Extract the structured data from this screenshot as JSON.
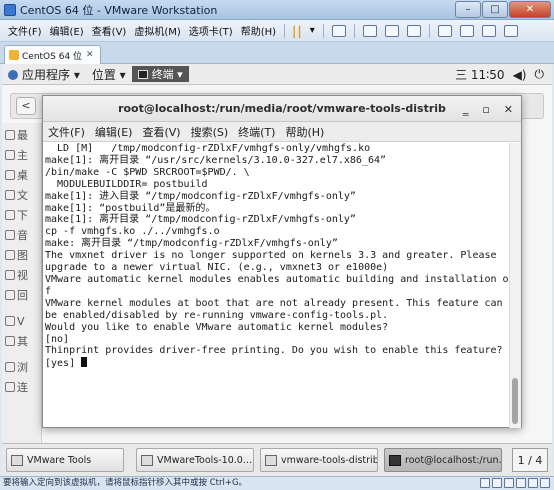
{
  "window": {
    "title": "CentOS 64 位 - VMware Workstation",
    "controls": {
      "minimize": "–",
      "maximize": "□",
      "close": "✕"
    }
  },
  "menubar": {
    "items": [
      "文件(F)",
      "编辑(E)",
      "查看(V)",
      "虚拟机(M)",
      "选项卡(T)",
      "帮助(H)"
    ],
    "dropdown_arrow": "▾"
  },
  "vm_tab": {
    "label": "CentOS 64 位",
    "close": "✕"
  },
  "gnome_topbar": {
    "applications": "应用程序 ▾",
    "places": "位置 ▾",
    "terminal_label": "终端 ▾",
    "clock": "三 11∶50",
    "volume_icon": "◀)",
    "power_icon": "⏻"
  },
  "files_window": {
    "back_button": "<",
    "sidebar_labels": [
      "最",
      "主",
      "桌",
      "文",
      "下",
      "音",
      "图",
      "视",
      "回",
      "V",
      "其",
      "浏",
      "连"
    ]
  },
  "terminal": {
    "title": "root@localhost:/run/media/root/vmware-tools-distrib",
    "controls": {
      "minimize": "‗",
      "maximize": "▫",
      "close": "✕"
    },
    "menu": [
      "文件(F)",
      "编辑(E)",
      "查看(V)",
      "搜索(S)",
      "终端(T)",
      "帮助(H)"
    ],
    "lines": [
      "  LD [M]   /tmp/modconfig-rZDlxF/vmhgfs-only/vmhgfs.ko",
      "make[1]: 离开目录 “/usr/src/kernels/3.10.0-327.el7.x86_64”",
      "/bin/make -C $PWD SRCROOT=$PWD/. \\",
      "  MODULEBUILDDIR= postbuild",
      "make[1]: 进入目录 “/tmp/modconfig-rZDlxF/vmhgfs-only”",
      "make[1]: “postbuild”是最新的。",
      "make[1]: 离开目录 “/tmp/modconfig-rZDlxF/vmhgfs-only”",
      "cp -f vmhgfs.ko ./../vmhgfs.o",
      "make: 离开目录 “/tmp/modconfig-rZDlxF/vmhgfs-only”",
      "",
      "The vmxnet driver is no longer supported on kernels 3.3 and greater. Please",
      "upgrade to a newer virtual NIC. (e.g., vmxnet3 or e1000e)",
      "",
      "VMware automatic kernel modules enables automatic building and installation o",
      "f",
      "VMware kernel modules at boot that are not already present. This feature can",
      "be enabled/disabled by re-running vmware-config-tools.pl.",
      "",
      "Would you like to enable VMware automatic kernel modules?",
      "[no]",
      "",
      "Thinprint provides driver-free printing. Do you wish to enable this feature?",
      "[yes] "
    ]
  },
  "taskbar": {
    "tasks": [
      "VMware Tools",
      "VMwareTools-10.0.…",
      "vmware-tools-distrib",
      "root@localhost:/run…"
    ],
    "workspace": "1 / 4"
  },
  "statusbar": {
    "text": "要将输入定向到该虚拟机，请将鼠标指针移入其中或按 Ctrl+G。"
  }
}
